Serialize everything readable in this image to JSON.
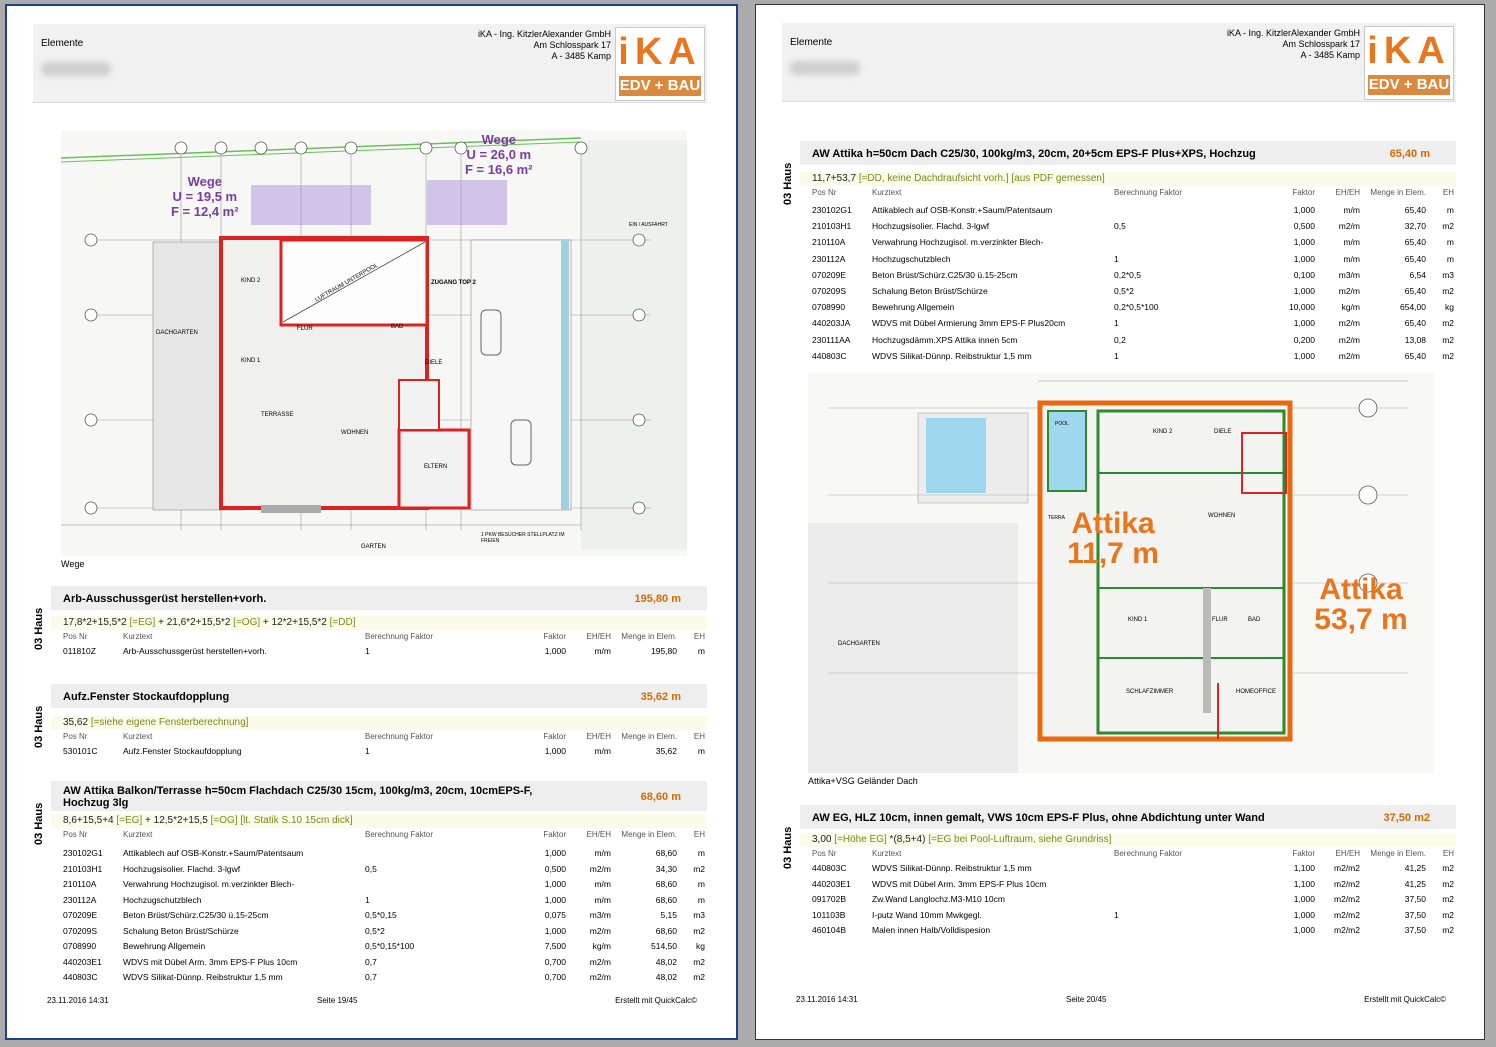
{
  "header": {
    "elemente": "Elemente",
    "company": "iKA - Ing. KitzlerAlexander GmbH",
    "street": "Am Schlosspark 17",
    "city": "A - 3485 Kamp",
    "logo_top": "iKA",
    "logo_bottom": "EDV + BAU"
  },
  "footer": {
    "date": "23.11.2016 14:31",
    "created": "Erstellt mit QuickCalc©",
    "page_left": "Seite 19/45",
    "page_right": "Seite 20/45"
  },
  "columns": {
    "pos": "Pos Nr",
    "kurz": "Kurztext",
    "ber": "Berechnung Faktor",
    "fak": "Faktor",
    "eheh": "EH/EH",
    "menge": "Menge in Elem.",
    "eh": "EH"
  },
  "haus": "03 Haus",
  "left": {
    "plan_caption": "Wege",
    "plan_labels": {
      "wege1": "Wege",
      "u1": "U = 19,5 m",
      "f1": "F = 12,4 m²",
      "wege2": "Wege",
      "u2": "U = 26,0 m",
      "f2": "F = 16,6 m²",
      "top2": "ZUGANG TOP 2",
      "garten": "GARTEN",
      "dachgarten": "DACHGARTEN",
      "wohnen": "WOHNEN",
      "eltern": "ELTERN",
      "kind1": "KIND 1",
      "kind2": "KIND 2",
      "terrasse": "TERRASSE",
      "flur": "FLUR",
      "bad": "BAD",
      "diele": "DIELE",
      "luftraum": "LUFTRAUM UNTERPOOL",
      "einfahrt": "EIN / AUSFAHRT",
      "stellplatz": "1 PKW BESUCHER STELLPLATZ IM FREIEN"
    },
    "s1": {
      "title": "Arb-Ausschussgerüst herstellen+vorh.",
      "total": "195,80  m",
      "formula": "17,8*2+15,5*2 ",
      "f_g1": "[=EG]",
      "formula2": "  +  21,6*2+15,5*2 ",
      "f_g2": "[=OG]",
      "formula3": "  +  12*2+15,5*2 ",
      "f_g3": "[=DD]",
      "rows": [
        {
          "pos": "011810Z",
          "kurz": "Arb-Ausschussgerüst herstellen+vorh.",
          "ber": "1",
          "fak": "1,000",
          "eheh": "m/m",
          "menge": "195,80",
          "eh": "m"
        }
      ]
    },
    "s2": {
      "title": "Aufz.Fenster Stockaufdopplung",
      "total": "35,62  m",
      "formula": "35,62 ",
      "f_g1": "[=siehe eigene Fensterberechnung]",
      "rows": [
        {
          "pos": "530101C",
          "kurz": "Aufz.Fenster Stockaufdopplung",
          "ber": "1",
          "fak": "1,000",
          "eheh": "m/m",
          "menge": "35,62",
          "eh": "m"
        }
      ]
    },
    "s3": {
      "title": "AW Attika Balkon/Terrasse h=50cm Flachdach C25/30 15cm, 100kg/m3, 20cm, 10cmEPS-F, Hochzug 3lg",
      "total": "68,60  m",
      "formula": "8,6+15,5+4 ",
      "f_g1": "[=EG]",
      "formula2": "  +  12,5*2+15,5 ",
      "f_g2": "[=OG]",
      "formula3": "  ",
      "f_g3": "[lt. Statik S.10 15cm dick]",
      "rows": [
        {
          "pos": "230102G1",
          "kurz": "Attikablech auf OSB-Konstr.+Saum/Patentsaum",
          "ber": "",
          "fak": "1,000",
          "eheh": "m/m",
          "menge": "68,60",
          "eh": "m"
        },
        {
          "pos": "210103H1",
          "kurz": "Hochzugsisolier. Flachd. 3-lgwf",
          "ber": "0,5",
          "fak": "0,500",
          "eheh": "m2/m",
          "menge": "34,30",
          "eh": "m2"
        },
        {
          "pos": "210110A",
          "kurz": "Verwahrung Hochzugisol. m.verzinkter Blech-",
          "ber": "",
          "fak": "1,000",
          "eheh": "m/m",
          "menge": "68,60",
          "eh": "m"
        },
        {
          "pos": "230112A",
          "kurz": "Hochzugschutzblech",
          "ber": "1",
          "fak": "1,000",
          "eheh": "m/m",
          "menge": "68,60",
          "eh": "m"
        },
        {
          "pos": "070209E",
          "kurz": "Beton Brüst/Schürz.C25/30 ü.15-25cm",
          "ber": "0,5*0,15",
          "fak": "0,075",
          "eheh": "m3/m",
          "menge": "5,15",
          "eh": "m3"
        },
        {
          "pos": "070209S",
          "kurz": "Schalung Beton Brüst/Schürze",
          "ber": "0,5*2",
          "fak": "1,000",
          "eheh": "m2/m",
          "menge": "68,60",
          "eh": "m2"
        },
        {
          "pos": "0708990",
          "kurz": "Bewehrung Allgemein",
          "ber": "0,5*0,15*100",
          "fak": "7,500",
          "eheh": "kg/m",
          "menge": "514,50",
          "eh": "kg"
        },
        {
          "pos": "440203E1",
          "kurz": "WDVS mit Dübel Arm. 3mm EPS-F Plus 10cm",
          "ber": "0,7",
          "fak": "0,700",
          "eheh": "m2/m",
          "menge": "48,02",
          "eh": "m2"
        },
        {
          "pos": "440803C",
          "kurz": "WDVS Silikat-Dünnp. Reibstruktur 1,5 mm",
          "ber": "0,7",
          "fak": "0,700",
          "eheh": "m2/m",
          "menge": "48,02",
          "eh": "m2"
        }
      ]
    }
  },
  "right": {
    "plan_caption": "Attika+VSG Geländer Dach",
    "plan_labels": {
      "attika1": "Attika",
      "attika1_val": "11,7 m",
      "attika2": "Attika",
      "attika2_val": "53,7 m",
      "kind1": "KIND 1",
      "kind2": "KIND 2",
      "wohnen": "WOHNEN",
      "diele": "DIELE",
      "flur": "FLUR",
      "bad": "BAD",
      "schlafzimmer": "SCHLAFZIMMER",
      "homeoffice": "HOMEOFFICE",
      "dachgarten": "DACHGARTEN",
      "pool": "POOL",
      "terra": "TERRA"
    },
    "s1": {
      "title": "AW Attika h=50cm Dach C25/30, 100kg/m3, 20cm, 20+5cm EPS-F Plus+XPS, Hochzug",
      "total": "65,40  m",
      "formula": "11,7+53,7 ",
      "f_g1": "[=DD, keine Dachdraufsicht vorh.]",
      "formula2": "  ",
      "f_g2": "[aus PDF gemessen]",
      "rows": [
        {
          "pos": "230102G1",
          "kurz": "Attikablech auf OSB-Konstr.+Saum/Patentsaum",
          "ber": "",
          "fak": "1,000",
          "eheh": "m/m",
          "menge": "65,40",
          "eh": "m"
        },
        {
          "pos": "210103H1",
          "kurz": "Hochzugsisolier. Flachd. 3-lgwf",
          "ber": "0,5",
          "fak": "0,500",
          "eheh": "m2/m",
          "menge": "32,70",
          "eh": "m2"
        },
        {
          "pos": "210110A",
          "kurz": "Verwahrung Hochzugisol. m.verzinkter Blech-",
          "ber": "",
          "fak": "1,000",
          "eheh": "m/m",
          "menge": "65,40",
          "eh": "m"
        },
        {
          "pos": "230112A",
          "kurz": "Hochzugschutzblech",
          "ber": "1",
          "fak": "1,000",
          "eheh": "m/m",
          "menge": "65,40",
          "eh": "m"
        },
        {
          "pos": "070209E",
          "kurz": "Beton Brüst/Schürz.C25/30 ü.15-25cm",
          "ber": "0,2*0,5",
          "fak": "0,100",
          "eheh": "m3/m",
          "menge": "6,54",
          "eh": "m3"
        },
        {
          "pos": "070209S",
          "kurz": "Schalung Beton Brüst/Schürze",
          "ber": "0,5*2",
          "fak": "1,000",
          "eheh": "m2/m",
          "menge": "65,40",
          "eh": "m2"
        },
        {
          "pos": "0708990",
          "kurz": "Bewehrung Allgemein",
          "ber": "0,2*0,5*100",
          "fak": "10,000",
          "eheh": "kg/m",
          "menge": "654,00",
          "eh": "kg"
        },
        {
          "pos": "440203JA",
          "kurz": "WDVS mit Dübel Armierung 3mm EPS-F Plus20cm",
          "ber": "1",
          "fak": "1,000",
          "eheh": "m2/m",
          "menge": "65,40",
          "eh": "m2"
        },
        {
          "pos": "230111AA",
          "kurz": "Hochzugsdämm.XPS Attika innen 5cm",
          "ber": "0,2",
          "fak": "0,200",
          "eheh": "m2/m",
          "menge": "13,08",
          "eh": "m2"
        },
        {
          "pos": "440803C",
          "kurz": "WDVS Silikat-Dünnp. Reibstruktur 1,5 mm",
          "ber": "1",
          "fak": "1,000",
          "eheh": "m2/m",
          "menge": "65,40",
          "eh": "m2"
        }
      ]
    },
    "s2": {
      "title": "AW EG, HLZ 10cm, innen  gemalt, VWS 10cm EPS-F Plus, ohne Abdichtung unter Wand",
      "total": "37,50  m2",
      "formula": "3,00 ",
      "f_g1": "[=Höhe EG]",
      "formula2": "  *(8,5+4) ",
      "f_g2": "[=EG bei Pool-Luftraum, siehe Grundriss]",
      "rows": [
        {
          "pos": "440803C",
          "kurz": "WDVS Silikat-Dünnp. Reibstruktur 1,5 mm",
          "ber": "",
          "fak": "1,100",
          "eheh": "m2/m2",
          "menge": "41,25",
          "eh": "m2"
        },
        {
          "pos": "440203E1",
          "kurz": "WDVS mit Dübel Arm. 3mm EPS-F Plus 10cm",
          "ber": "",
          "fak": "1,100",
          "eheh": "m2/m2",
          "menge": "41,25",
          "eh": "m2"
        },
        {
          "pos": "091702B",
          "kurz": "Zw.Wand Langlochz.M3-M10 10cm",
          "ber": "",
          "fak": "1,000",
          "eheh": "m2/m2",
          "menge": "37,50",
          "eh": "m2"
        },
        {
          "pos": "101103B",
          "kurz": "I-putz Wand 10mm Mwkgegl.",
          "ber": "1",
          "fak": "1,000",
          "eheh": "m2/m2",
          "menge": "37,50",
          "eh": "m2"
        },
        {
          "pos": "460104B",
          "kurz": "Malen innen Halb/Volldispesion",
          "ber": "",
          "fak": "1,000",
          "eheh": "m2/m2",
          "menge": "37,50",
          "eh": "m2"
        }
      ]
    }
  }
}
